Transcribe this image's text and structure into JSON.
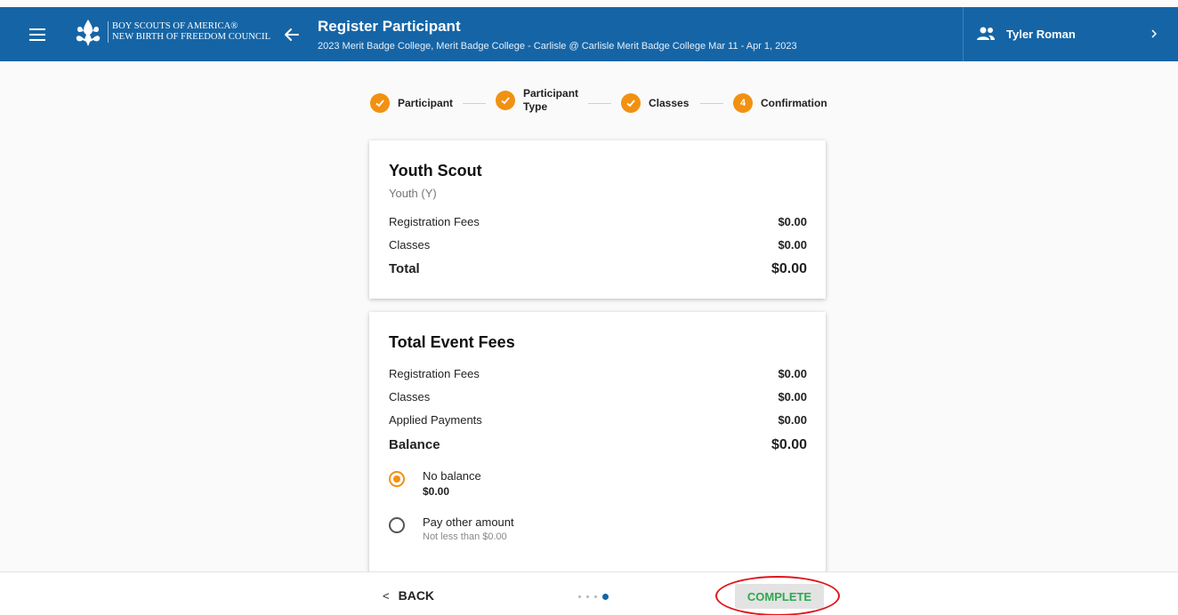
{
  "header": {
    "org_line1": "BOY SCOUTS OF AMERICA®",
    "org_line2": "NEW BIRTH OF FREEDOM COUNCIL",
    "title": "Register Participant",
    "subtitle": "2023 Merit Badge College, Merit Badge College - Carlisle @ Carlisle Merit Badge College Mar 11 - Apr 1, 2023",
    "user_name": "Tyler Roman",
    "icons": {
      "menu": "menu-icon",
      "logo": "fleur-de-lis-logo",
      "back": "arrow-left-icon",
      "user": "group-icon",
      "expand": "chevron-right-icon"
    }
  },
  "stepper": {
    "steps": [
      {
        "label": "Participant",
        "state": "done",
        "marker": ""
      },
      {
        "label_line1": "Participant",
        "label_line2": "Type",
        "state": "done",
        "marker": ""
      },
      {
        "label": "Classes",
        "state": "done",
        "marker": ""
      },
      {
        "label": "Confirmation",
        "state": "current",
        "marker": "4"
      }
    ]
  },
  "participant_card": {
    "title": "Youth Scout",
    "subtitle": "Youth (Y)",
    "rows": [
      {
        "label": "Registration Fees",
        "amount": "$0.00"
      },
      {
        "label": "Classes",
        "amount": "$0.00"
      }
    ],
    "total_label": "Total",
    "total_amount": "$0.00"
  },
  "event_card": {
    "title": "Total Event Fees",
    "rows": [
      {
        "label": "Registration Fees",
        "amount": "$0.00"
      },
      {
        "label": "Classes",
        "amount": "$0.00"
      },
      {
        "label": "Applied Payments",
        "amount": "$0.00"
      }
    ],
    "balance_label": "Balance",
    "balance_amount": "$0.00",
    "options": [
      {
        "label": "No balance",
        "detail": "$0.00",
        "checked": true
      },
      {
        "label": "Pay other amount",
        "detail": "Not less than $0.00",
        "checked": false
      }
    ]
  },
  "footer": {
    "back_label": "BACK",
    "complete_label": "COMPLETE",
    "page_dots": 4,
    "active_dot": 4
  },
  "colors": {
    "header_bg": "#1565a6",
    "accent_orange": "#f29111",
    "complete_green": "#2fa84f",
    "annotation_red": "#e0161c"
  }
}
